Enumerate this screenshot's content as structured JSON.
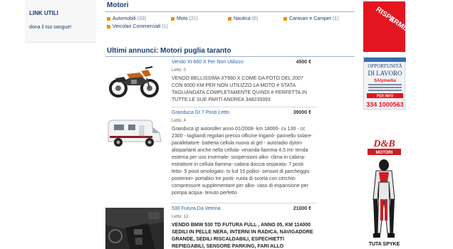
{
  "sidebar": {
    "title": "LINK UTILI",
    "link": "dona il tuo sangue!"
  },
  "motori": {
    "title": "Motori",
    "categories": [
      {
        "label": "Automobili",
        "count": "(33)"
      },
      {
        "label": "Moto",
        "count": "(21)"
      },
      {
        "label": "Nautica",
        "count": "(6)"
      },
      {
        "label": "Caravan e Camper",
        "count": "(1)"
      },
      {
        "label": "Veicolari Commerciali",
        "count": "(1)"
      }
    ]
  },
  "ads": {
    "title": "Ultimi annunci: Motori puglia taranto",
    "items": [
      {
        "title": "Vendo Xt 660 X Per Non Utilizzo",
        "price": "4500 €",
        "reads": "Letto: 0",
        "desc": "VENDO BELLISSIMA XT660 X COME DA FOTO DEL 2007 CON 6000 KM PER NON UTILIZZO LA MOTO è STATA TAGLIANDATA COMPLETAMENTE QUINDI è PERFETTA IN TUTTE LE SUE PARTI ANDREA 348239393"
      },
      {
        "title": "Granduca Gt 7 Posti Letto",
        "price": "39000 €",
        "reads": "Letto: 4",
        "desc": "Granduca gt autoroller anno 01/2008- km 18000- cv 130 - cc 2300 - tagliandi regolari presso officine triganò- pannello solare- parallelatore- batteria cellula nuova al gel - autoradio dyton- altoparlanti anche nella cellula- veranda fiamma 4,5 mt- tenda esterna per uso invernale- sospensioni alko- clima in cabina- estrattore in cellula fiamma- cabina doccia separata- 7 posti letto- 5 posti omologato- tv lcd 15 pollici- sensori di parcheggio posteriori- portabici tre posti- ruota di scorta con cerchio- compressore supplementare per alko- vaso di espansione per pompa acqua- tenuto perfetto"
      },
      {
        "title": "530 Futura Da Vetrina",
        "price": "21000 €",
        "reads": "Letto: 12",
        "desc": "VENDO BMW 530 TD FUTURA FULL , ANNO 05, KM 114000 SEDILI IN PELLE NERA, INTERNI IN RADICA, NAVIGADORE GRANDE, SEDILI RISCALDABILI, ESPECHIETTI REPIEGABILI, SENSORE PARKING, FARI ALLO"
      }
    ]
  },
  "banners": {
    "risparmia_line1": "E",
    "risparmia_line2": "RISPARMIA",
    "opportunita": "OPPORTUNITÀ",
    "di_lavoro": "DI LAVORO",
    "brand": "SAlymedia",
    "per_info": "PER INFO",
    "phone": "334 1000563",
    "db_logo": "D&B",
    "db_motori": "MOTORI",
    "tuta": "TUTA SPYKE"
  },
  "colors": {
    "accent": "#1a3d73",
    "orange": "#f28c00",
    "link": "#2a5fa8",
    "red": "#e4151f"
  }
}
